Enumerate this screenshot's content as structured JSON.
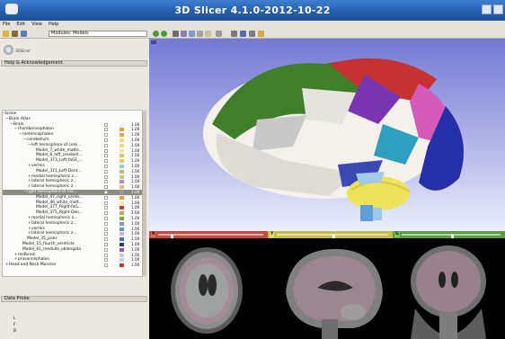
{
  "window": {
    "title": "3D Slicer 4.1.0-2012-10-22"
  },
  "menu": {
    "file": "File",
    "edit": "Edit",
    "view": "View",
    "help": "Help"
  },
  "toolbar": {
    "modules_label": "Modules:",
    "module_selected": "Models"
  },
  "panel": {
    "logo_text": "3DSlicer",
    "help_section": "Help & Acknowledgement",
    "data_probe_section": "Data Probe",
    "axes": [
      "L",
      "F",
      "B"
    ]
  },
  "tree": [
    {
      "label": "Scene",
      "depth": 0,
      "toggle": "−"
    },
    {
      "label": "Brain Atlas",
      "depth": 1,
      "toggle": "−"
    },
    {
      "label": "Brain",
      "depth": 2,
      "toggle": "−",
      "color": "#f7f7f7",
      "opacity": "1.00"
    },
    {
      "label": "rhombencephalon",
      "depth": 3,
      "toggle": "−",
      "color": "#e7a33c",
      "opacity": "1.00"
    },
    {
      "label": "metencephalon",
      "depth": 4,
      "toggle": "−",
      "color": "#e7a33c",
      "opacity": "1.00"
    },
    {
      "label": "cerebellum",
      "depth": 5,
      "toggle": "−",
      "color": "#e9e07a",
      "opacity": "1.00"
    },
    {
      "label": "left hemisphere of cere...",
      "depth": 6,
      "toggle": "−",
      "color": "#e9e07a",
      "opacity": "1.00"
    },
    {
      "label": "Model_7_white_matte...",
      "depth": 7,
      "color": "#f0e7a2",
      "opacity": "1.00"
    },
    {
      "label": "Model_8_left_cerebell...",
      "depth": 7,
      "color": "#d9c36a",
      "opacity": "1.00"
    },
    {
      "label": "Model_373_Left-faGE_...",
      "depth": 7,
      "color": "#e4d04a",
      "opacity": "1.00"
    },
    {
      "label": "vermis",
      "depth": 6,
      "toggle": "+",
      "color": "#8ccfe0",
      "opacity": "1.00"
    },
    {
      "label": "Model_371_Left-Dent...",
      "depth": 7,
      "color": "#c9b566",
      "opacity": "1.00"
    },
    {
      "label": "medial hemispheric z...",
      "depth": 6,
      "toggle": "+",
      "color": "#b5d27a",
      "opacity": "1.00"
    },
    {
      "label": "lateral hemispheric z...",
      "depth": 6,
      "toggle": "+",
      "color": "#c983c4",
      "opacity": "1.00"
    },
    {
      "label": "lateral hemispheric z...",
      "depth": 6,
      "toggle": "+",
      "color": "#e6b68c",
      "opacity": "1.00"
    },
    {
      "label": "right hemisphere of cer...",
      "depth": 5,
      "toggle": "−",
      "color": "#9b9b9b",
      "opacity": "1.00",
      "selected": true
    },
    {
      "label": "Model_47_right_cereb...",
      "depth": 7,
      "color": "#e79f2f",
      "opacity": "1.00"
    },
    {
      "label": "Model_46_white_matt...",
      "depth": 7,
      "color": "#f1ea9a",
      "opacity": "1.00"
    },
    {
      "label": "Model_377_Right-faG...",
      "depth": 7,
      "color": "#d13b2f",
      "opacity": "1.00"
    },
    {
      "label": "Model_375_Right-Den...",
      "depth": 7,
      "color": "#c7a64d",
      "opacity": "1.00"
    },
    {
      "label": "medial hemispheric z...",
      "depth": 6,
      "toggle": "+",
      "color": "#6fb33c",
      "opacity": "1.00"
    },
    {
      "label": "lateral hemispheric z...",
      "depth": 6,
      "toggle": "+",
      "color": "#8f8fbf",
      "opacity": "1.00"
    },
    {
      "label": "vermis",
      "depth": 6,
      "toggle": "+",
      "color": "#5b9bd8",
      "opacity": "1.00"
    },
    {
      "label": "lateral hemispheric z...",
      "depth": 6,
      "toggle": "+",
      "color": "#cdb6d8",
      "opacity": "1.00"
    },
    {
      "label": "Model_35_pons",
      "depth": 5,
      "color": "#4b6fb2",
      "opacity": "1.00"
    },
    {
      "label": "Model_15_fourth_ventricle",
      "depth": 4,
      "color": "#2b3a8c",
      "opacity": "1.00"
    },
    {
      "label": "Model_61_medulla_oblongata",
      "depth": 4,
      "color": "#8a5ab1",
      "opacity": "1.00"
    },
    {
      "label": "midbrain",
      "depth": 3,
      "toggle": "+",
      "color": "#c9c9c9",
      "opacity": "1.00"
    },
    {
      "label": "prosencephalon",
      "depth": 3,
      "toggle": "+",
      "color": "#d8c8e4",
      "opacity": "1.00"
    },
    {
      "label": "Head and Neck Muscles",
      "depth": 1,
      "toggle": "+",
      "color": "#c6382c",
      "opacity": "1.00"
    }
  ],
  "slices": [
    {
      "label": "R",
      "bar_color": "#c44b42",
      "lbl_bg": "#e46a60",
      "position": 0.12
    },
    {
      "label": "Y",
      "bar_color": "#c9bd4a",
      "lbl_bg": "#e8dc6b",
      "position": 0.5
    },
    {
      "label": "G",
      "bar_color": "#5c9b3e",
      "lbl_bg": "#7cc35a",
      "position": 0.5
    }
  ],
  "colors": {
    "title_bar": "#245bab",
    "panel_bg": "#ebe8e2",
    "view_bg": "#7579d4"
  }
}
